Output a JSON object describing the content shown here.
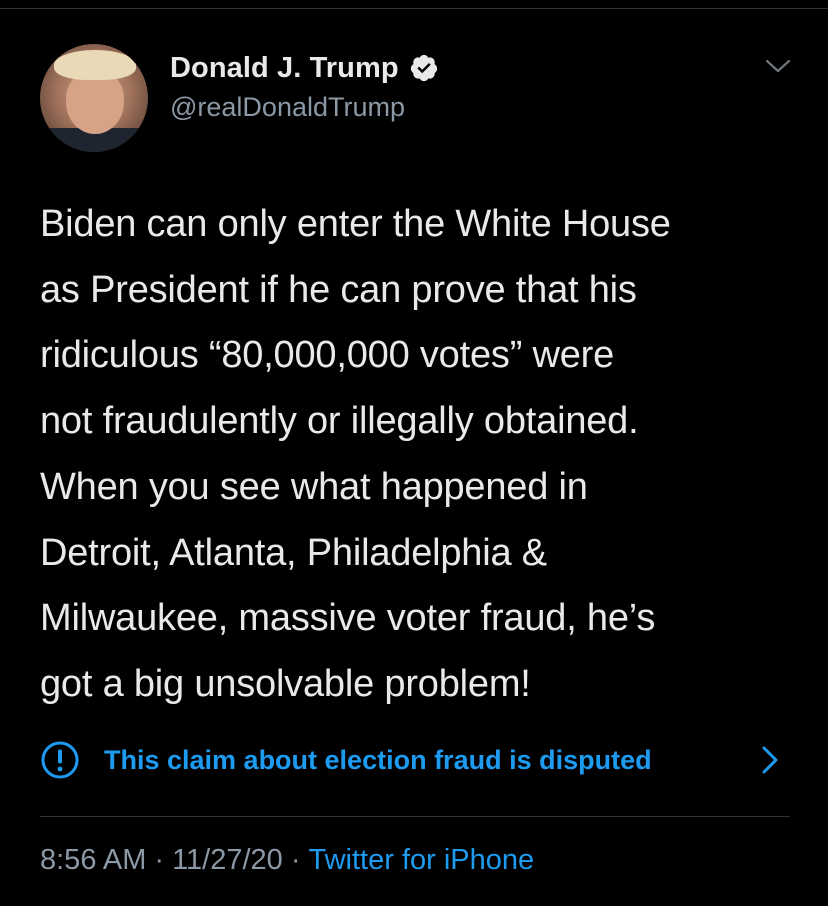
{
  "author": {
    "display_name": "Donald J. Trump",
    "handle": "@realDonaldTrump",
    "verified": true
  },
  "tweet": {
    "text": "Biden can only enter the White House\nas President if he can prove that his\nridiculous “80,000,000 votes” were\nnot fraudulently or illegally obtained.\nWhen you see what happened in\nDetroit, Atlanta, Philadelphia &\nMilwaukee, massive voter fraud, he’s\ngot a big unsolvable problem!"
  },
  "notice": {
    "icon": "exclamation-circle-icon",
    "text": "This claim about election fraud is disputed"
  },
  "meta": {
    "time": "8:56 AM",
    "separator": "·",
    "date": "11/27/20",
    "source": "Twitter for iPhone"
  },
  "colors": {
    "background": "#000000",
    "text": "#e7e9ea",
    "secondary": "#8b98a5",
    "accent": "#1d9bf0",
    "divider": "#2f3336"
  }
}
